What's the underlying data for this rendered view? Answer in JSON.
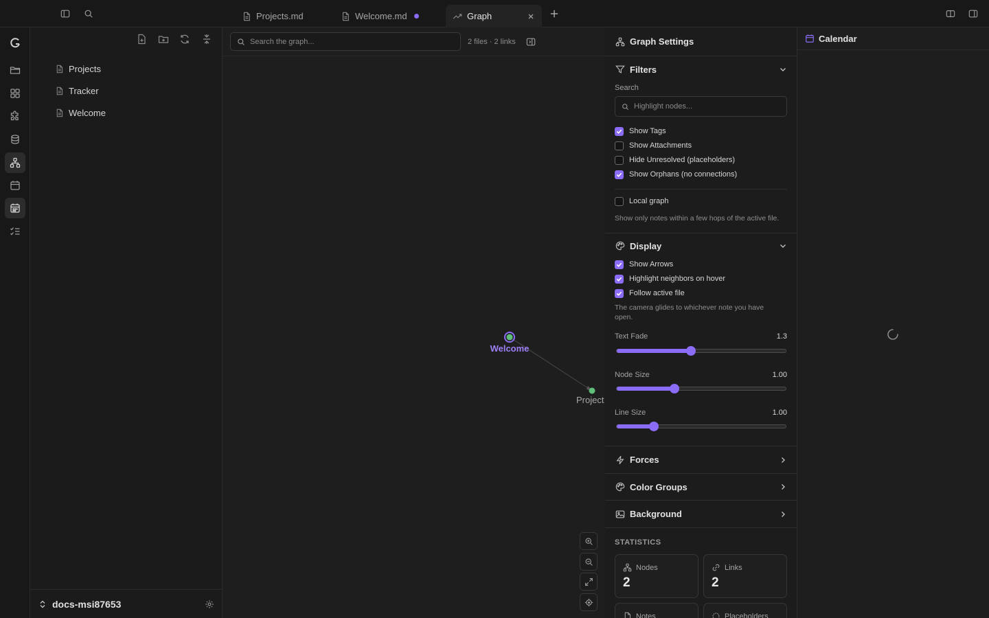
{
  "tabs": [
    {
      "label": "Projects.md",
      "icon": "file-icon"
    },
    {
      "label": "Welcome.md",
      "icon": "file-icon",
      "unsaved": true
    },
    {
      "label": "Graph",
      "icon": "graph-trend-icon",
      "active": true
    }
  ],
  "explorer": {
    "files": [
      "Projects",
      "Tracker",
      "Welcome"
    ],
    "vault_name": "docs-msi87653"
  },
  "graph": {
    "search_placeholder": "Search the graph...",
    "stats": "2 files · 2 links",
    "nodes": [
      {
        "label": "Welcome",
        "active": true
      },
      {
        "label": "Project"
      }
    ]
  },
  "settings": {
    "title": "Graph Settings",
    "filters": {
      "title": "Filters",
      "search_label": "Search",
      "search_placeholder": "Highlight nodes...",
      "options": [
        {
          "label": "Show Tags",
          "checked": true
        },
        {
          "label": "Show Attachments",
          "checked": false
        },
        {
          "label": "Hide Unresolved (placeholders)",
          "checked": false
        },
        {
          "label": "Show Orphans (no connections)",
          "checked": true
        }
      ],
      "local_graph": {
        "label": "Local graph",
        "checked": false
      },
      "local_hint": "Show only notes within a few hops of the active file."
    },
    "display": {
      "title": "Display",
      "options": [
        {
          "label": "Show Arrows",
          "checked": true
        },
        {
          "label": "Highlight neighbors on hover",
          "checked": true
        },
        {
          "label": "Follow active file",
          "checked": true
        }
      ],
      "follow_hint": "The camera glides to whichever note you have open.",
      "sliders": [
        {
          "label": "Text Fade",
          "value": "1.3",
          "fraction": 0.44
        },
        {
          "label": "Node Size",
          "value": "1.00",
          "fraction": 0.34
        },
        {
          "label": "Line Size",
          "value": "1.00",
          "fraction": 0.22
        }
      ]
    },
    "collapsed_sections": [
      {
        "title": "Forces",
        "icon": "bolt-icon"
      },
      {
        "title": "Color Groups",
        "icon": "palette-icon"
      },
      {
        "title": "Background",
        "icon": "image-icon"
      }
    ],
    "statistics": {
      "title": "STATISTICS",
      "cards": [
        {
          "label": "Nodes",
          "value": "2",
          "icon": "nodes-icon"
        },
        {
          "label": "Links",
          "value": "2",
          "icon": "link-icon"
        },
        {
          "label": "Notes",
          "value": "",
          "icon": "note-icon"
        },
        {
          "label": "Placeholders",
          "value": "",
          "icon": "placeholder-icon"
        }
      ]
    }
  },
  "calendar": {
    "title": "Calendar"
  },
  "colors": {
    "accent": "#8b6cf6",
    "node": "#5fbf7a",
    "background": "#1e1e1e"
  }
}
